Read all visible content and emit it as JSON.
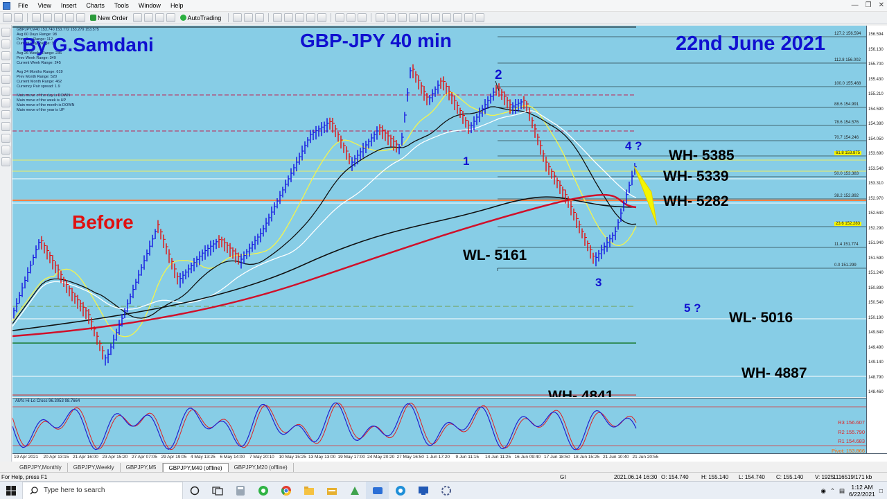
{
  "menu": {
    "items": [
      "File",
      "View",
      "Insert",
      "Charts",
      "Tools",
      "Window",
      "Help"
    ]
  },
  "toolbar": {
    "new_order": "New Order",
    "autotrading": "AutoTrading"
  },
  "chart": {
    "symbol_line": "GBPJPY,M40  153.740 153.772 153.279 153.575",
    "info_lines": [
      "Avg 60 Days Range: 98",
      "Prev Day Range: 112",
      "Current Day Range: 34",
      "",
      "Avg 26 Weeks Range: 236",
      "Prev Week Range: 349",
      "Current Week Range: 245",
      "",
      "Avg 24 Months Range: 619",
      "Prev Month Range: 520",
      "Current Month Range: 462",
      "Currency Pair spread: 1.9",
      "",
      "Main move of the day is DOWN",
      "Main move of the week is UP",
      "Main move of the month is DOWN",
      "Main move of the year is UP"
    ],
    "author": "By G.Samdani",
    "title": "GBP-JPY 40 min",
    "date": "22nd June 2021",
    "before": "Before",
    "wave_labels": {
      "w1": "1",
      "w2": "2",
      "w3": "3",
      "w4": "4 ?",
      "w5": "5 ?"
    },
    "levels": {
      "wh5385": "WH- 5385",
      "wh5339": "WH- 5339",
      "wh5282": "WH- 5282",
      "wl5161": "WL- 5161",
      "wl5016": "WL- 5016",
      "wh4887": "WH- 4887",
      "wh4841": "WH- 4841"
    },
    "fib": [
      {
        "label": "127.2 156.594"
      },
      {
        "label": "112.8 156.002"
      },
      {
        "label": "100.0 155.468"
      },
      {
        "label": "88.6 154.991"
      },
      {
        "label": "78.6 154.576"
      },
      {
        "label": "70.7 154.246"
      },
      {
        "label": "61.8 153.875"
      },
      {
        "label": "50.0 153.383"
      },
      {
        "label": "38.2 152.892"
      },
      {
        "label": "23.6 152.283"
      },
      {
        "label": "11.4 151.774"
      },
      {
        "label": "0.0 151.299"
      }
    ]
  },
  "indicator": {
    "label": "AM's Hi-Lo Cross 96.3053 98.7664",
    "pivots": [
      "R3 156.607",
      "R2 155.790",
      "R1 154.683",
      "Pivot: 153.866"
    ]
  },
  "price_axis": [
    "156.594",
    "156.130",
    "155.700",
    "155.430",
    "155.210",
    "154.590",
    "154.380",
    "154.050",
    "153.690",
    "153.540",
    "153.310",
    "152.970",
    "152.640",
    "152.290",
    "151.940",
    "151.590",
    "151.240",
    "150.890",
    "150.540",
    "150.190",
    "149.840",
    "149.490",
    "149.140",
    "148.790",
    "148.460"
  ],
  "time_axis": [
    "19 Apr 2021",
    "20 Apr 13:15",
    "21 Apr 16:00",
    "23 Apr 15:20",
    "27 Apr 07:05",
    "29 Apr 19:05",
    "4 May 13:25",
    "6 May 14:00",
    "7 May 20:10",
    "10 May 15:25",
    "13 May 13:00",
    "19 May 17:00",
    "24 May 20:20",
    "27 May 16:50",
    "1 Jun 17:20",
    "9 Jun 11:15",
    "14 Jun 11:25",
    "16 Jun 09:40",
    "17 Jun 18:50",
    "18 Jun 15:25",
    "21 Jun 10:40",
    "21 Jun 20:55"
  ],
  "tabs": [
    "GBPJPY,Monthly",
    "GBPJPY,Weekly",
    "GBPJPY,M5",
    "GBPJPY,M40 (offline)",
    "GBPJPY,M20 (offline)"
  ],
  "active_tab": 3,
  "status": {
    "help": "For Help, press F1",
    "profile": "GI",
    "datetime": "2021.06.14 16:30",
    "open": "O: 154.740",
    "high": "H: 155.140",
    "low": "L: 154.740",
    "close": "C: 155.140",
    "volume": "V: 1925",
    "traffic": "1116519/171 kb"
  },
  "taskbar": {
    "search_placeholder": "Type here to search",
    "time": "1:12 AM",
    "date": "6/22/2021"
  },
  "colors": {
    "chart_bg": "#87cde6",
    "bull": "#1010e0",
    "bear": "#e01010",
    "ma_red": "#d0102a",
    "ma_yellow": "#f5f54a"
  }
}
